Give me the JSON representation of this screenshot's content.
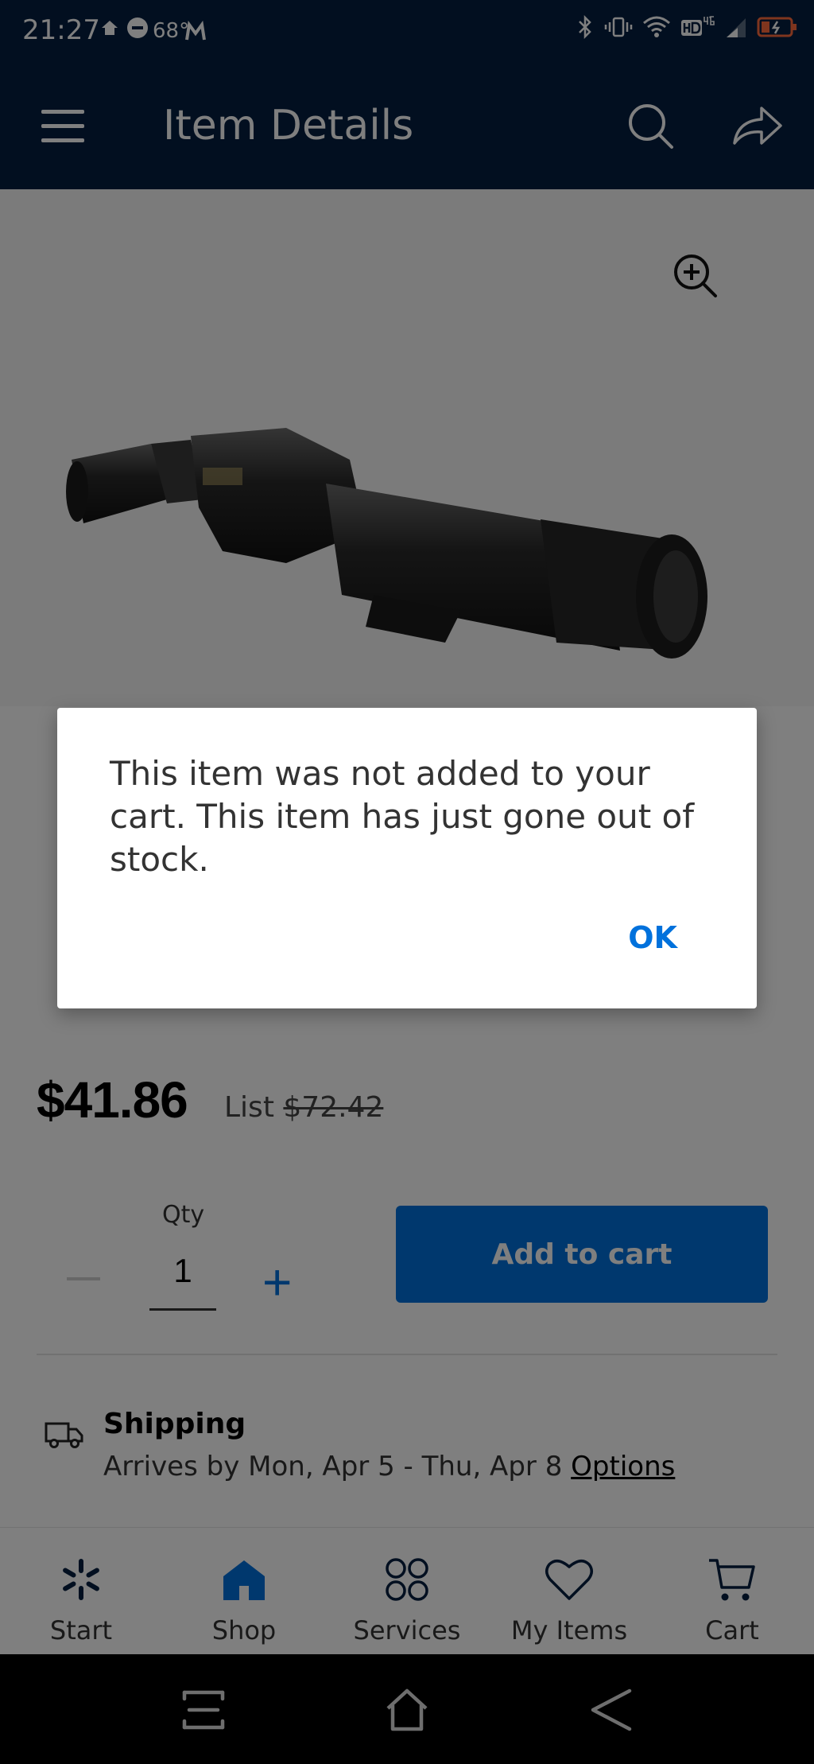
{
  "status_bar": {
    "time": "21:27",
    "temperature": "68°"
  },
  "header": {
    "title": "Item Details",
    "menu_icon": "hamburger-icon",
    "search_icon": "search-icon",
    "share_icon": "share-icon",
    "background": "#041f41"
  },
  "product": {
    "price": "$41.86",
    "list_label": "List",
    "list_price": "$72.42"
  },
  "quantity": {
    "label": "Qty",
    "value": "1",
    "minus": "−",
    "plus": "+"
  },
  "add_to_cart": {
    "label": "Add to cart",
    "color": "#0071dc"
  },
  "shipping": {
    "title": "Shipping",
    "description": "Arrives by Mon, Apr 5 - Thu, Apr 8",
    "options_link": "Options"
  },
  "bottom_nav": {
    "items": [
      {
        "label": "Start",
        "icon": "spark-icon"
      },
      {
        "label": "Shop",
        "icon": "home-icon"
      },
      {
        "label": "Services",
        "icon": "grid-icon"
      },
      {
        "label": "My Items",
        "icon": "heart-icon"
      },
      {
        "label": "Cart",
        "icon": "cart-icon"
      }
    ]
  },
  "dialog": {
    "message": "This item was not added to your cart. This item has just gone out of stock.",
    "ok_label": "OK"
  }
}
